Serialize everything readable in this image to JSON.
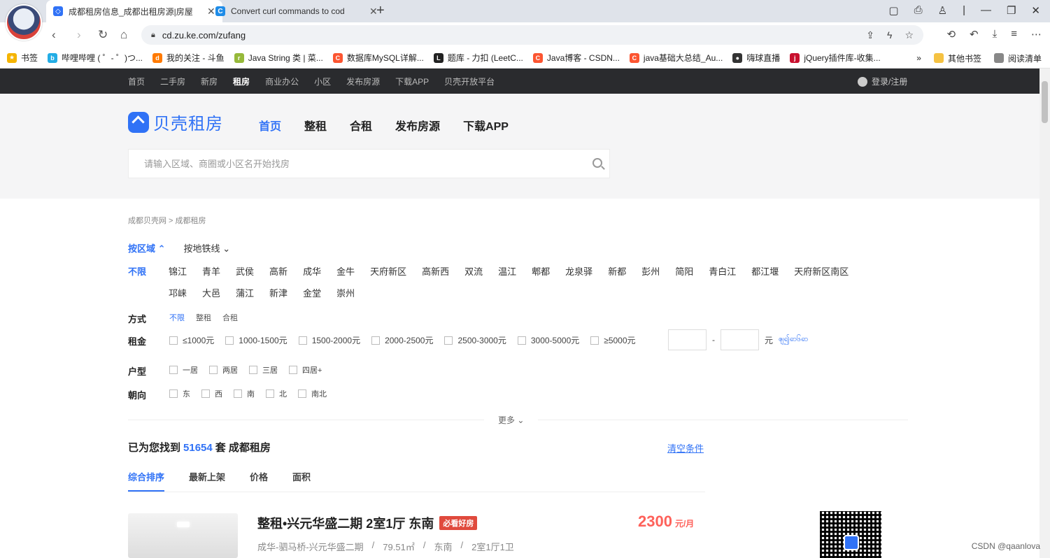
{
  "browser": {
    "tabs": [
      {
        "favicon": "beike-favicon",
        "title": "成都租房信息_成都出租房源|房屋"
      },
      {
        "favicon": "c-favicon",
        "title": "Convert curl commands to cod"
      }
    ],
    "url": "cd.zu.ke.com/zufang",
    "bookmarks": [
      {
        "label": "书签",
        "icon": "star-icon",
        "color": "#f5b400"
      },
      {
        "label": "哔哩哔哩 ( ゜- ゜)つ...",
        "icon": "bilibili-icon",
        "color": "#23ade5"
      },
      {
        "label": "我的关注 - 斗鱼",
        "icon": "douyu-icon",
        "color": "#ff7a00"
      },
      {
        "label": "Java String 类 | 菜...",
        "icon": "runoob-icon",
        "color": "#96b93a"
      },
      {
        "label": "数据库MySQL详解...",
        "icon": "csdn-icon",
        "color": "#fc5531"
      },
      {
        "label": "题库 - 力扣 (LeetC...",
        "icon": "leetcode-icon",
        "color": "#222222"
      },
      {
        "label": "Java博客 - CSDN...",
        "icon": "csdn-icon",
        "color": "#fc5531"
      },
      {
        "label": "java基础大总结_Au...",
        "icon": "csdn-icon",
        "color": "#fc5531"
      },
      {
        "label": "嗨球直播",
        "icon": "ball-icon",
        "color": "#333333"
      },
      {
        "label": "jQuery插件库-收集...",
        "icon": "jquery-icon",
        "color": "#c8102e"
      }
    ],
    "bookmarks_more": "»",
    "other_bookmarks": "其他书签",
    "reading_list": "阅读清单"
  },
  "site_nav": {
    "links": [
      "首页",
      "二手房",
      "新房",
      "租房",
      "商业办公",
      "小区",
      "发布房源",
      "下载APP",
      "贝壳开放平台"
    ],
    "active": "租房",
    "login": "登录/注册"
  },
  "header": {
    "logo_text": "贝壳租房",
    "nav": [
      "首页",
      "整租",
      "合租",
      "发布房源",
      "下载APP"
    ],
    "active_nav": "首页",
    "search_placeholder": "请输入区域、商圈或小区名开始找房"
  },
  "filters": {
    "breadcrumb": "成都贝壳网 > 成都租房",
    "region_tab": "按区域",
    "metro_tab": "按地铁线",
    "districts_all": "不限",
    "districts_row1": [
      "锦江",
      "青羊",
      "武侯",
      "高新",
      "成华",
      "金牛",
      "天府新区",
      "高新西",
      "双流",
      "温江",
      "郫都",
      "龙泉驿",
      "新都",
      "彭州",
      "简阳",
      "青白江",
      "都江堰",
      "天府新区南区"
    ],
    "districts_row2": [
      "邛崃",
      "大邑",
      "蒲江",
      "新津",
      "金堂",
      "崇州"
    ],
    "mode_label": "方式",
    "mode_options": [
      "不限",
      "整租",
      "合租"
    ],
    "rent_label": "租金",
    "rent_options": [
      "≤1000元",
      "1000-1500元",
      "1500-2000元",
      "2000-2500元",
      "2500-3000元",
      "3000-5000元",
      "≥5000元"
    ],
    "rent_dash": "-",
    "rent_unit": "元",
    "rent_confirm": "ၛ၍ၹ၆ၹ",
    "layout_label": "户型",
    "layout_options": [
      "一居",
      "两居",
      "三居",
      "四居+"
    ],
    "orient_label": "朝向",
    "orient_options": [
      "东",
      "西",
      "南",
      "北",
      "南北"
    ],
    "more": "更多"
  },
  "results": {
    "prefix": "已为您找到",
    "count": "51654",
    "suffix": "套 成都租房",
    "clear": "清空条件",
    "sort_tabs": [
      "综合排序",
      "最新上架",
      "价格",
      "面积"
    ],
    "listing": {
      "title": "整租•兴元华盛二期 2室1厅 东南",
      "badge": "必看好房",
      "price": "2300",
      "price_unit": "元/月",
      "location": "成华-驷马桥-兴元华盛二期",
      "area": "79.51㎡",
      "orientation": "东南",
      "layout": "2室1厅1卫"
    }
  },
  "watermark": "CSDN @qaanlova",
  "colors": {
    "accent": "#3072f6",
    "price": "#fe615a",
    "badge": "#e04a3d",
    "topnav": "#2a2b2e"
  }
}
